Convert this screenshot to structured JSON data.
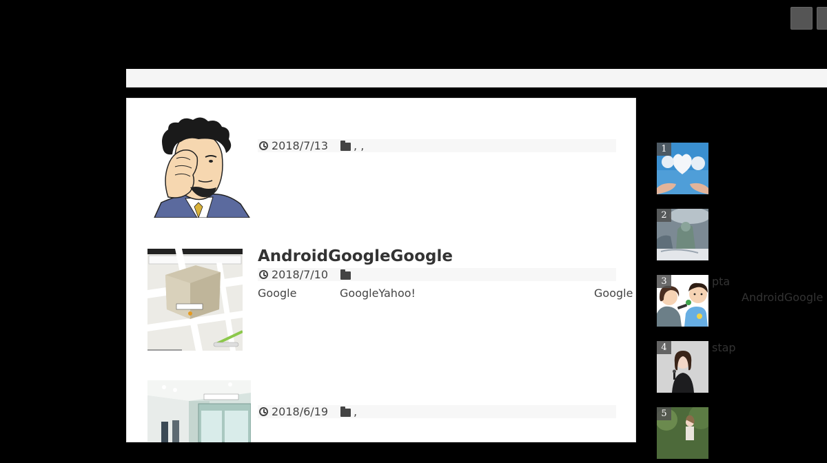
{
  "header": {
    "buttons": [
      "",
      ""
    ]
  },
  "posts": [
    {
      "title": "",
      "date": "2018/7/13",
      "categories": ", ,",
      "excerpt": []
    },
    {
      "title": "AndroidGoogleGoogle",
      "date": "2018/7/10",
      "categories": "",
      "excerpt": [
        "Google",
        "GoogleYahoo!",
        "Google"
      ]
    },
    {
      "title": "",
      "date": "2018/6/19",
      "categories": ",",
      "excerpt": []
    }
  ],
  "overflow_text": {
    "android_google": "AndroidGoogle"
  },
  "ranking": [
    {
      "rank": "1",
      "text": ""
    },
    {
      "rank": "2",
      "text": ""
    },
    {
      "rank": "3",
      "text": "pta"
    },
    {
      "rank": "4",
      "text": "stap"
    },
    {
      "rank": "5",
      "text": ""
    }
  ]
}
